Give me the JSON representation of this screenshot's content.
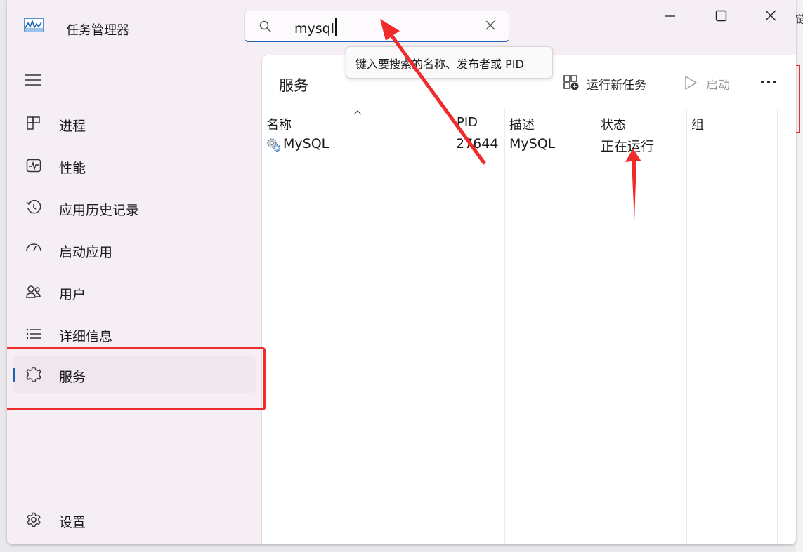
{
  "window": {
    "title": "任务管理器",
    "controls": [
      "minimize",
      "maximize",
      "close"
    ]
  },
  "search": {
    "value": "mysql",
    "tooltip": "键入要搜索的名称、发布者或 PID"
  },
  "sidebar": {
    "items": [
      {
        "label": "进程",
        "icon": "processes-icon"
      },
      {
        "label": "性能",
        "icon": "performance-icon"
      },
      {
        "label": "应用历史记录",
        "icon": "app-history-icon"
      },
      {
        "label": "启动应用",
        "icon": "startup-apps-icon"
      },
      {
        "label": "用户",
        "icon": "users-icon"
      },
      {
        "label": "详细信息",
        "icon": "details-icon"
      },
      {
        "label": "服务",
        "icon": "services-icon",
        "active": true
      }
    ],
    "settings_label": "设置"
  },
  "page": {
    "title": "服务",
    "run_new_task_label": "运行新任务",
    "start_label": "启动"
  },
  "table": {
    "headers": [
      "名称",
      "PID",
      "描述",
      "状态",
      "组"
    ],
    "rows": [
      {
        "name": "MySQL",
        "pid": "27644",
        "description": "MySQL",
        "status": "正在运行",
        "group": ""
      }
    ]
  },
  "background": {
    "edge_char": "链"
  },
  "colors": {
    "accent": "#1a63b8",
    "annotation_red": "#ef2b2b",
    "sidebar_bg": "#f6eef5"
  }
}
